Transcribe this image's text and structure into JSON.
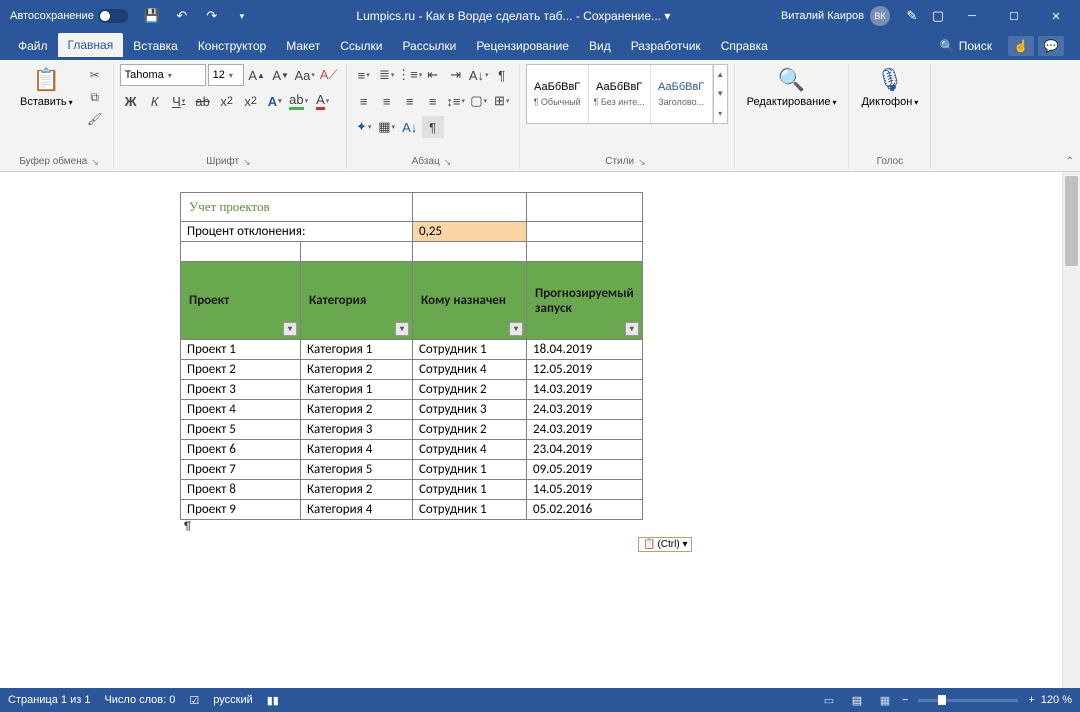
{
  "titlebar": {
    "autosave": "Автосохранение",
    "title": "Lumpics.ru - Как в Ворде сделать таб...  -  Сохранение... ▾",
    "user": "Виталий Каиров",
    "initials": "ВК"
  },
  "tabs": {
    "file": "Файл",
    "home": "Главная",
    "insert": "Вставка",
    "design": "Конструктор",
    "layout": "Макет",
    "references": "Ссылки",
    "mailings": "Рассылки",
    "review": "Рецензирование",
    "view": "Вид",
    "developer": "Разработчик",
    "help": "Справка",
    "search": "Поиск"
  },
  "ribbon": {
    "clipboard": {
      "paste": "Вставить",
      "label": "Буфер обмена"
    },
    "font": {
      "name": "Tahoma",
      "size": "12",
      "label": "Шрифт",
      "bold": "Ж",
      "italic": "К",
      "underline": "Ч",
      "strike": "ab"
    },
    "para": {
      "label": "Абзац"
    },
    "styles": {
      "label": "Стили",
      "preview": "АаБбВвГ",
      "s1": "¶ Обычный",
      "s2": "¶ Без инте...",
      "s3": "Заголово..."
    },
    "editing": {
      "label": "Редактирование"
    },
    "voice": {
      "btn": "Диктофон",
      "label": "Голос"
    }
  },
  "doc": {
    "title": "Учет проектов",
    "pct_label": "Процент отклонения:",
    "pct_val": "0,25",
    "headers": {
      "c1": "Проект",
      "c2": "Категория",
      "c3": "Кому назначен",
      "c4": "Прогнозируемый запуск"
    },
    "rows": [
      {
        "p": "Проект 1",
        "k": "Категория 1",
        "s": "Сотрудник 1",
        "d": "18.04.2019"
      },
      {
        "p": "Проект 2",
        "k": "Категория 2",
        "s": "Сотрудник 4",
        "d": "12.05.2019"
      },
      {
        "p": "Проект 3",
        "k": "Категория 1",
        "s": "Сотрудник 2",
        "d": "14.03.2019"
      },
      {
        "p": "Проект 4",
        "k": "Категория 2",
        "s": "Сотрудник 3",
        "d": "24.03.2019"
      },
      {
        "p": "Проект 5",
        "k": "Категория 3",
        "s": "Сотрудник 2",
        "d": "24.03.2019"
      },
      {
        "p": "Проект 6",
        "k": "Категория 4",
        "s": "Сотрудник 4",
        "d": "23.04.2019"
      },
      {
        "p": "Проект 7",
        "k": "Категория 5",
        "s": "Сотрудник 1",
        "d": "09.05.2019"
      },
      {
        "p": "Проект 8",
        "k": "Категория 2",
        "s": "Сотрудник 1",
        "d": "14.05.2019"
      },
      {
        "p": "Проект 9",
        "k": "Категория 4",
        "s": "Сотрудник 1",
        "d": "05.02.2016"
      }
    ],
    "paste_opts": "(Ctrl) ▾"
  },
  "status": {
    "page": "Страница 1 из 1",
    "words": "Число слов: 0",
    "lang": "русский",
    "zoom": "120 %"
  }
}
